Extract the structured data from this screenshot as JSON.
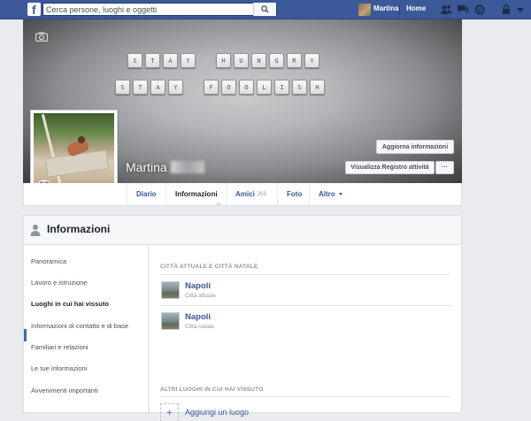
{
  "topbar": {
    "logo": "f",
    "search_placeholder": "Cerca persone, luoghi e oggetti",
    "user_name": "Martina",
    "home_label": "Home"
  },
  "cover": {
    "keys_row1": [
      "S",
      "T",
      "A",
      "Y",
      "",
      "H",
      "U",
      "N",
      "G",
      "R",
      "Y"
    ],
    "keys_row2": [
      "S",
      "T",
      "A",
      "Y",
      "",
      "F",
      "O",
      "O",
      "L",
      "I",
      "S",
      "H"
    ],
    "update_info_label": "Aggiorna informazioni",
    "activity_log_label": "Visualizza Registro attività",
    "more_label": "···",
    "profile_name": "Martina"
  },
  "profile_nav": {
    "tabs": [
      {
        "label": "Diario"
      },
      {
        "label": "Informazioni"
      },
      {
        "label": "Amici",
        "count": "253"
      },
      {
        "label": "Foto"
      },
      {
        "label": "Altro"
      }
    ]
  },
  "info": {
    "title": "Informazioni",
    "sidebar": [
      {
        "label": "Panoramica"
      },
      {
        "label": "Lavoro e istruzione"
      },
      {
        "label": "Luoghi in cui hai vissuto",
        "active": true
      },
      {
        "label": "Informazioni di contatto e di base"
      },
      {
        "label": "Familiari e relazioni"
      },
      {
        "label": "Le tue informazioni"
      },
      {
        "label": "Avvenimenti importanti"
      }
    ],
    "current_section_title": "CITTÀ ATTUALE E CITTÀ NATALE",
    "places": [
      {
        "name": "Napoli",
        "subtitle": "Città attuale"
      },
      {
        "name": "Napoli",
        "subtitle": "Città natale"
      }
    ],
    "other_section_title": "ALTRI LUOGHI IN CUI HAI VISSUTO",
    "add_place_label": "Aggiungi un luogo",
    "add_symbol": "+"
  }
}
